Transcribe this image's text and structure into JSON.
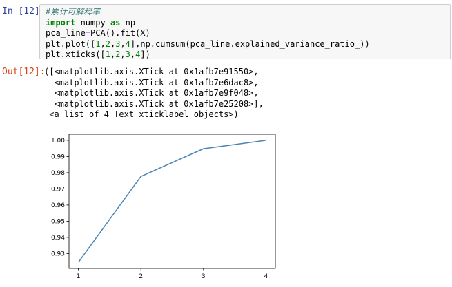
{
  "input_prompt": "In [12]:",
  "output_prompt": "Out[12]:",
  "code": {
    "comment": "#累计可解释率",
    "line2": {
      "kw1": "import",
      "mod": " numpy ",
      "kw2": "as",
      "alias": " np"
    },
    "line3": {
      "a": "pca_line",
      "op": "=",
      "b": "PCA().fit(X)"
    },
    "line4": {
      "a": "plt.plot([",
      "n1": "1",
      "s1": ",",
      "n2": "2",
      "s2": ",",
      "n3": "3",
      "s3": ",",
      "n4": "4",
      "b": "],np.cumsum(pca_line.explained_variance_ratio_))"
    },
    "line5": {
      "a": "plt.xticks([",
      "n1": "1",
      "s1": ",",
      "n2": "2",
      "s2": ",",
      "n3": "3",
      "s3": ",",
      "n4": "4",
      "b": "])"
    }
  },
  "output_lines": [
    "([<matplotlib.axis.XTick at 0x1afb7e91550>,",
    "  <matplotlib.axis.XTick at 0x1afb7e6dac8>,",
    "  <matplotlib.axis.XTick at 0x1afb7e9f048>,",
    "  <matplotlib.axis.XTick at 0x1afb7e25208>],",
    " <a list of 4 Text xticklabel objects>)"
  ],
  "chart_data": {
    "type": "line",
    "x": [
      1,
      2,
      3,
      4
    ],
    "series": [
      {
        "values": [
          0.9246,
          0.9777,
          0.9948,
          1.0
        ],
        "color": "#4682B4"
      }
    ],
    "xticks": [
      "1",
      "2",
      "3",
      "4"
    ],
    "yticks": [
      "0.93",
      "0.94",
      "0.95",
      "0.96",
      "0.97",
      "0.98",
      "0.99",
      "1.00"
    ],
    "ytick_values": [
      0.93,
      0.94,
      0.95,
      0.96,
      0.97,
      0.98,
      0.99,
      1.0
    ],
    "xlim": [
      0.85,
      4.15
    ],
    "ylim": [
      0.9208,
      1.0038
    ],
    "grid": false,
    "title": "",
    "xlabel": "",
    "ylabel": ""
  }
}
